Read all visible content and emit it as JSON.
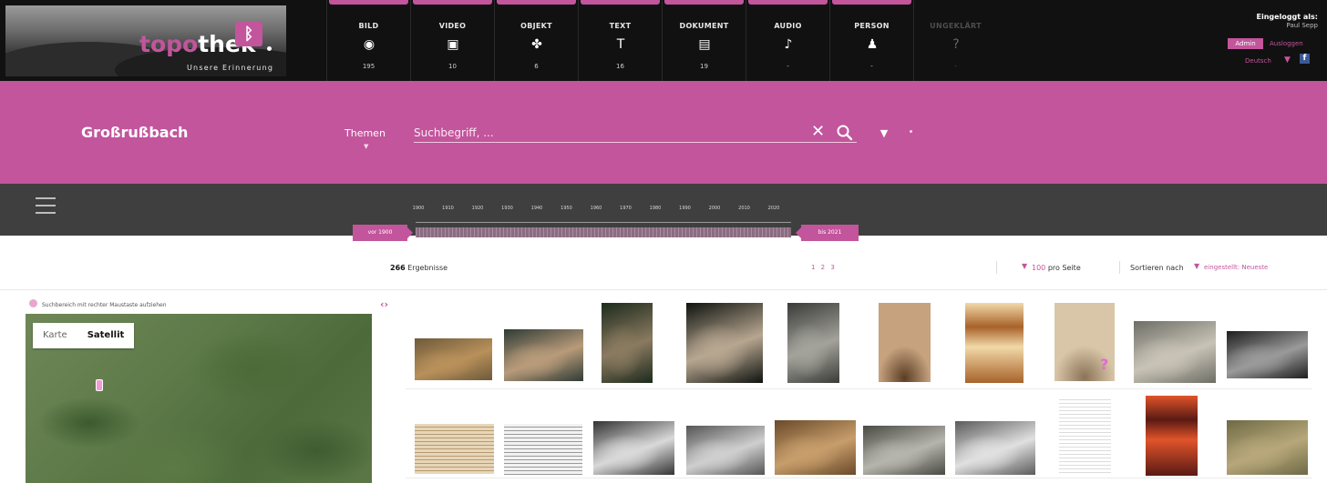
{
  "header": {
    "logo": {
      "brand_a": "topo",
      "brand_b": "thek",
      "tagline": "Unsere Erinnerung"
    },
    "categories": [
      {
        "label": "BILD",
        "icon": "camera-icon",
        "glyph": "◉",
        "count": "195",
        "dim": false
      },
      {
        "label": "VIDEO",
        "icon": "video-icon",
        "glyph": "▣",
        "count": "10",
        "dim": false
      },
      {
        "label": "OBJEKT",
        "icon": "object-icon",
        "glyph": "✤",
        "count": "6",
        "dim": false
      },
      {
        "label": "TEXT",
        "icon": "text-icon",
        "glyph": "T",
        "count": "16",
        "dim": false
      },
      {
        "label": "DOKUMENT",
        "icon": "document-icon",
        "glyph": "▤",
        "count": "19",
        "dim": false
      },
      {
        "label": "AUDIO",
        "icon": "audio-icon",
        "glyph": "♪",
        "count": "-",
        "dim": false
      },
      {
        "label": "PERSON",
        "icon": "person-icon",
        "glyph": "♟",
        "count": "-",
        "dim": false
      },
      {
        "label": "UNGEKLÄRT",
        "icon": "question-icon",
        "glyph": "?",
        "count": "-",
        "dim": true
      }
    ],
    "login": {
      "title": "Eingeloggt als:",
      "user": "Paul Sepp",
      "admin_label": "Admin",
      "logout_label": "Ausloggen",
      "language": "Deutsch"
    }
  },
  "search": {
    "place": "Großrußbach",
    "themes_label": "Themen",
    "placeholder": "Suchbegriff, ..."
  },
  "timeline": {
    "years": [
      "1900",
      "1910",
      "1920",
      "1930",
      "1940",
      "1950",
      "1960",
      "1970",
      "1980",
      "1990",
      "2000",
      "2010",
      "2020"
    ],
    "from_label": "vor 1900",
    "to_label": "bis 2021"
  },
  "results": {
    "count": "266",
    "count_label": "Ergebnisse",
    "pages": "1  2  3",
    "per_page_value": "100",
    "per_page_label": "pro Seite",
    "sort_label": "Sortieren nach",
    "sort_value": "eingestellt: Neueste"
  },
  "map": {
    "hint": "Suchbereich mit rechter Maustaste aufziehen",
    "tab_map": "Karte",
    "tab_satellite": "Satellit",
    "collapse_glyph": "‹›"
  },
  "thumbnails": {
    "row1": [
      {
        "kind": "group-photo",
        "c1": "#6e5a3a",
        "c2": "#b8905a"
      },
      {
        "kind": "group-photo",
        "c1": "#2f3b35",
        "c2": "#b89b7a"
      },
      {
        "kind": "night-photo",
        "c1": "#1d2a1c",
        "c2": "#8a7a60"
      },
      {
        "kind": "night-photo",
        "c1": "#0f130f",
        "c2": "#b7a690"
      },
      {
        "kind": "bw-photo",
        "c1": "#3a3a38",
        "c2": "#a3a39b"
      },
      {
        "kind": "sepia-portrait",
        "c1": "#5a3d24",
        "c2": "#c6a27e"
      },
      {
        "kind": "poster",
        "c1": "#a8622a",
        "c2": "#f1d9a8"
      },
      {
        "kind": "portrait",
        "c1": "#8b7357",
        "c2": "#d9c6a8"
      },
      {
        "kind": "building-photo",
        "c1": "#6e6e66",
        "c2": "#c8c3b6"
      },
      {
        "kind": "bw-photo",
        "c1": "#1e1e1e",
        "c2": "#9a9a9a"
      }
    ],
    "row2": [
      {
        "kind": "document",
        "c1": "#b89a72",
        "c2": "#e7d6b8"
      },
      {
        "kind": "document",
        "c1": "#9a9a9a",
        "c2": "#f2f2f2"
      },
      {
        "kind": "bw-photo",
        "c1": "#333333",
        "c2": "#d9d9d9"
      },
      {
        "kind": "bw-photo",
        "c1": "#555555",
        "c2": "#cfcfcf"
      },
      {
        "kind": "sepia-photo",
        "c1": "#6a4a2a",
        "c2": "#c79d6b"
      },
      {
        "kind": "bw-photo",
        "c1": "#4a4a44",
        "c2": "#b5b5ad"
      },
      {
        "kind": "bw-photo",
        "c1": "#5b5b5b",
        "c2": "#e0e0e0"
      },
      {
        "kind": "map-sketch",
        "c1": "#dcdcdc",
        "c2": "#ffffff"
      },
      {
        "kind": "poster",
        "c1": "#5a1a14",
        "c2": "#e0542a"
      },
      {
        "kind": "color-photo",
        "c1": "#6e6a45",
        "c2": "#b7a77a"
      }
    ],
    "unknown_mark": "?"
  },
  "colors": {
    "accent": "#c2559c",
    "dark_band": "#3f3f3f",
    "top_band": "#111111"
  }
}
